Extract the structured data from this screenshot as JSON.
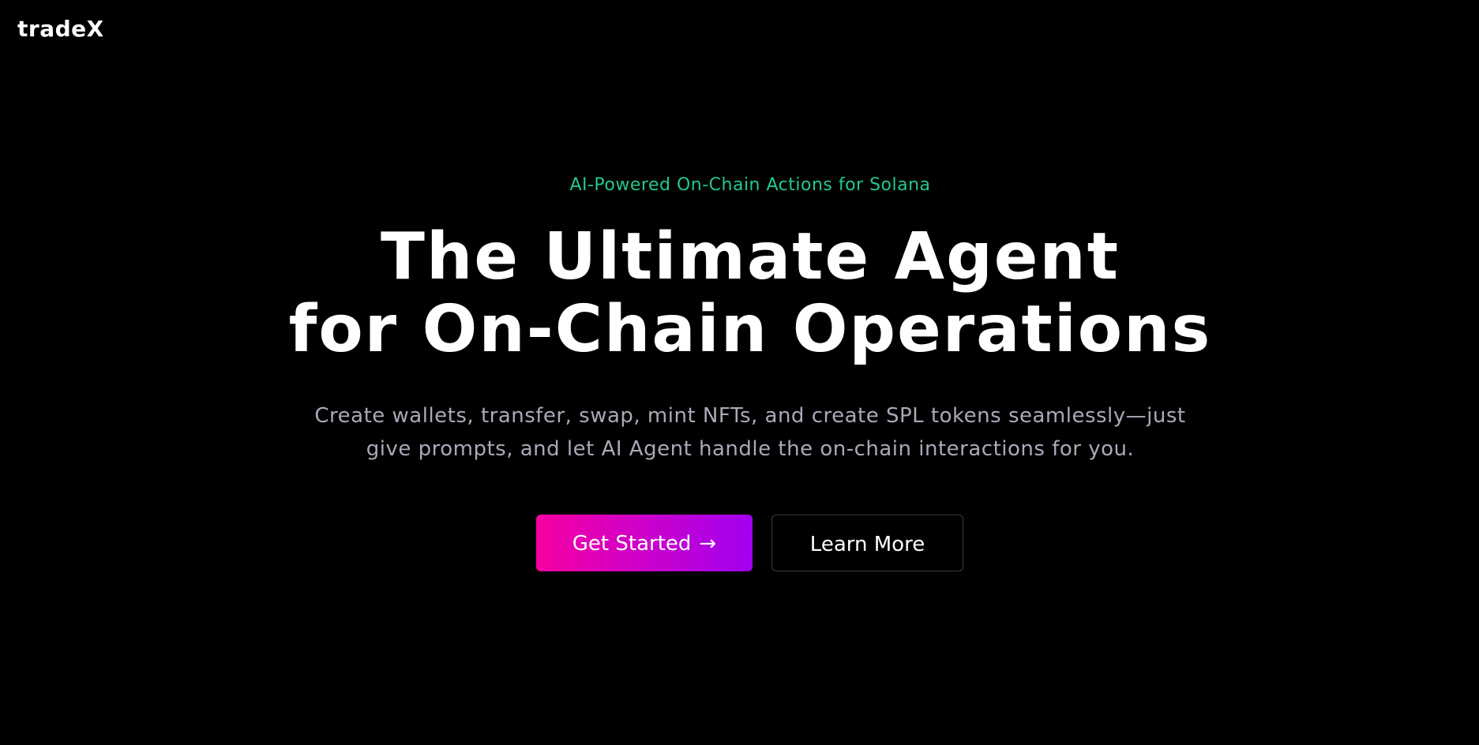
{
  "header": {
    "brand": "tradeX"
  },
  "hero": {
    "eyebrow": "AI-Powered On-Chain Actions for Solana",
    "headline_line1": "The Ultimate Agent",
    "headline_line2": "for On-Chain Operations",
    "subtitle": "Create wallets, transfer, swap, mint NFTs, and create SPL tokens seamlessly—just give prompts, and let AI Agent handle the on-chain interactions for you.",
    "primary_button": "Get Started",
    "primary_button_arrow": "→",
    "secondary_button": "Learn More"
  },
  "colors": {
    "background": "#000000",
    "eyebrow": "#22c98a",
    "subtitle": "#a9a9b8",
    "gradient_start": "#f700a1",
    "gradient_end": "#a100f2",
    "secondary_border": "#3a3a46"
  },
  "icons": {
    "primary_arrow": "arrow-right-icon"
  }
}
